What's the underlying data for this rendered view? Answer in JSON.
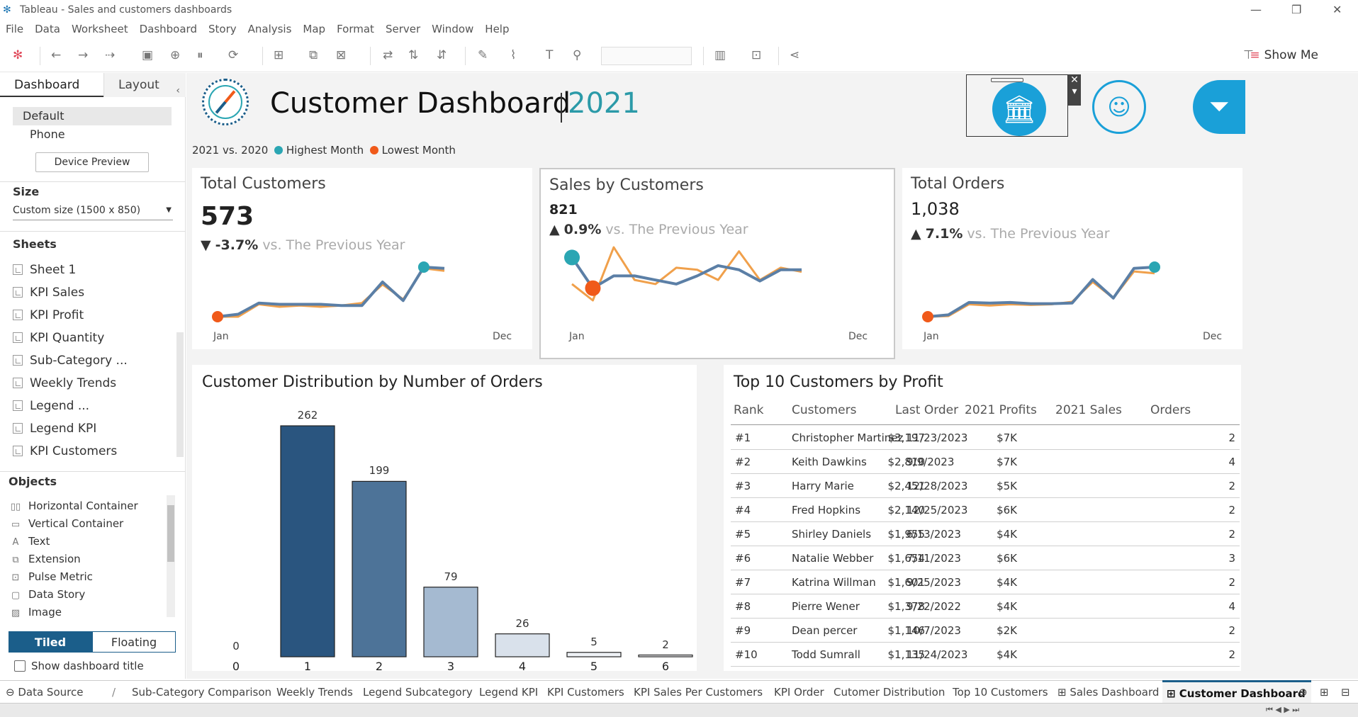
{
  "app": {
    "window_title": "Tableau - Sales and customers dashboards",
    "window_controls": [
      "minimize",
      "restore",
      "close"
    ]
  },
  "menu": [
    "File",
    "Data",
    "Worksheet",
    "Dashboard",
    "Story",
    "Analysis",
    "Map",
    "Format",
    "Server",
    "Window",
    "Help"
  ],
  "toolbar": {
    "show_me_label": "Show Me"
  },
  "left_panel": {
    "tabs": [
      "Dashboard",
      "Layout"
    ],
    "devices": [
      "Default",
      "Phone"
    ],
    "device_preview_label": "Device Preview",
    "size_heading": "Size",
    "size_value": "Custom size (1500 x 850)",
    "sheets_heading": "Sheets",
    "sheets": [
      "Sheet 1",
      "KPI Sales",
      "KPI Profit",
      "KPI Quantity",
      "Sub-Category ...",
      "Weekly Trends",
      "Legend ...",
      "Legend KPI",
      "KPI Customers"
    ],
    "objects_heading": "Objects",
    "objects": [
      "Horizontal Container",
      "Vertical Container",
      "Text",
      "Extension",
      "Pulse Metric",
      "Data Story",
      "Image"
    ],
    "tiled_label": "Tiled",
    "floating_label": "Floating",
    "show_title_label": "Show dashboard title"
  },
  "dashboard": {
    "title": "Customer Dashboard",
    "year": "2021",
    "legend": {
      "prefix": "2021  vs. 2020",
      "highest": "Highest Month",
      "lowest": "Lowest Month"
    },
    "colors": {
      "current": "#5b7fa6",
      "previous": "#f0a04b",
      "highest": "#2ba6b3",
      "lowest": "#f05a1a",
      "teal_accent": "#2b9aa8",
      "icon_bg": "#1aa0d8"
    },
    "kpis": [
      {
        "title": "Total Customers",
        "value": "573",
        "direction": "down",
        "change": "-3.7%",
        "vs": "vs. The Previous Year",
        "x_start": "Jan",
        "x_end": "Dec"
      },
      {
        "title": "Sales by Customers",
        "value": "821",
        "direction": "up",
        "change": "0.9%",
        "vs": "vs. The Previous Year",
        "x_start": "Jan",
        "x_end": "Dec"
      },
      {
        "title": "Total Orders",
        "value": "1,038",
        "direction": "up",
        "change": "7.1%",
        "vs": "vs. The Previous Year",
        "x_start": "Jan",
        "x_end": "Dec"
      }
    ],
    "distribution": {
      "title": "Customer Distribution by Number of Orders"
    },
    "top10": {
      "title": "Top 10 Customers by Profit",
      "columns": [
        "Rank",
        "Customers",
        "Last Order",
        "2021 Profits",
        "2021 Sales",
        "Orders"
      ],
      "rows": [
        [
          "#1",
          "Christopher Martinez",
          "11/23/2023",
          "$3,197",
          "$7K",
          "2"
        ],
        [
          "#2",
          "Keith Dawkins",
          "9/9/2023",
          "$2,810",
          "$7K",
          "4"
        ],
        [
          "#3",
          "Harry Marie",
          "12/28/2023",
          "$2,451",
          "$5K",
          "2"
        ],
        [
          "#4",
          "Fred Hopkins",
          "12/25/2023",
          "$2,140",
          "$6K",
          "2"
        ],
        [
          "#5",
          "Shirley Daniels",
          "6/13/2023",
          "$1,955",
          "$4K",
          "2"
        ],
        [
          "#6",
          "Natalie Webber",
          "7/11/2023",
          "$1,654",
          "$6K",
          "3"
        ],
        [
          "#7",
          "Katrina Willman",
          "9/25/2023",
          "$1,601",
          "$4K",
          "2"
        ],
        [
          "#8",
          "Pierre Wener",
          "9/22/2022",
          "$1,378",
          "$4K",
          "4"
        ],
        [
          "#9",
          "Dean percer",
          "10/7/2023",
          "$1,146",
          "$2K",
          "2"
        ],
        [
          "#10",
          "Todd Sumrall",
          "11/24/2023",
          "$1,135",
          "$4K",
          "2"
        ]
      ]
    }
  },
  "chart_data": [
    {
      "type": "line",
      "title": "Total Customers",
      "x": [
        "Jan",
        "Feb",
        "Mar",
        "Apr",
        "May",
        "Jun",
        "Jul",
        "Aug",
        "Sep",
        "Oct",
        "Nov",
        "Dec"
      ],
      "series": [
        {
          "values": [
            34,
            36,
            45,
            44,
            44,
            44,
            43,
            43,
            62,
            47,
            74,
            73
          ]
        },
        {
          "values": [
            34,
            34,
            44,
            42,
            43,
            42,
            43,
            45,
            60,
            48,
            73,
            71
          ]
        }
      ]
    },
    {
      "type": "line",
      "title": "Sales by Customers",
      "x": [
        "Jan",
        "Feb",
        "Mar",
        "Apr",
        "May",
        "Jun",
        "Jul",
        "Aug",
        "Sep",
        "Oct",
        "Nov",
        "Dec"
      ],
      "series": [
        {
          "values": [
            850,
            700,
            760,
            760,
            740,
            720,
            760,
            810,
            790,
            735,
            790,
            790
          ]
        },
        {
          "values": [
            720,
            640,
            900,
            740,
            720,
            800,
            790,
            740,
            880,
            740,
            800,
            780
          ]
        }
      ]
    },
    {
      "type": "line",
      "title": "Total Orders",
      "x": [
        "Jan",
        "Feb",
        "Mar",
        "Apr",
        "May",
        "Jun",
        "Jul",
        "Aug",
        "Sep",
        "Oct",
        "Nov",
        "Dec"
      ],
      "series": [
        {
          "values": [
            62,
            65,
            85,
            84,
            85,
            83,
            83,
            84,
            122,
            92,
            140,
            142
          ]
        },
        {
          "values": [
            62,
            63,
            82,
            80,
            82,
            81,
            82,
            86,
            118,
            92,
            135,
            132
          ]
        }
      ]
    },
    {
      "type": "bar",
      "title": "Customer Distribution by Number of Orders",
      "categories": [
        "0",
        "1",
        "2",
        "3",
        "4",
        "5",
        "6"
      ],
      "values": [
        0,
        262,
        199,
        79,
        26,
        5,
        2
      ],
      "colors": [
        "#2a557f",
        "#2a557f",
        "#4d7398",
        "#a5bad1",
        "#d9e1eb",
        "#eef1f5",
        "#f5f6f8"
      ]
    }
  ]
}
